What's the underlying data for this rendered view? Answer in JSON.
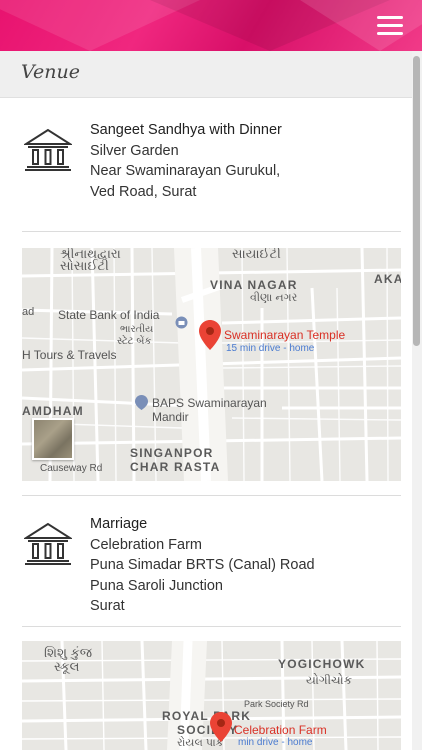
{
  "header": {
    "menu_icon": "hamburger-menu-icon"
  },
  "section": {
    "title": "Venue"
  },
  "venues": [
    {
      "icon": "temple-building-icon",
      "lines": [
        "Sangeet Sandhya with Dinner",
        "Silver Garden",
        "Near Swaminarayan Gurukul,",
        "Ved Road, Surat"
      ],
      "map": {
        "place_name": "Swaminarayan Temple",
        "drive_info": "15 min drive - home",
        "labels": {
          "vina_nagar": "VINA NAGAR",
          "vina_nagar_guj": "વીણા નગર",
          "society_guj_1": "શ્રીનાથદ્વારા",
          "society_guj_2": "સોસાઈટી",
          "society_guj_3": "સાયાઈટી",
          "aka": "AKA",
          "sbi": "State Bank of India",
          "sbi_guj_1": "ભારતીય",
          "sbi_guj_2": "સ્ટેટ બેંક",
          "tours": "H Tours & Travels",
          "amdham": "AMDHAM",
          "baps": "BAPS Swaminarayan",
          "mandir": "Mandir",
          "singanpor": "SINGANPOR",
          "char_rasta": "CHAR RASTA",
          "causeway": "Causeway Rd",
          "ad": "ad"
        }
      }
    },
    {
      "icon": "temple-building-icon",
      "lines": [
        "Marriage",
        "Celebration Farm",
        "Puna Simadar BRTS (Canal) Road",
        "Puna Saroli Junction",
        "Surat"
      ],
      "map": {
        "place_name": "Celebration Farm",
        "drive_info": "min drive - home",
        "labels": {
          "shishu_1": "શિશુ કુંજ",
          "shishu_2": "સ્કૂલ",
          "yogichowk": "YOGICHOWK",
          "yogichowk_guj": "યોગીચોક",
          "royal_park": "ROYAL PARK",
          "society": "SOCIETY",
          "royal_guj": "રોયલ પાર્ક",
          "park_rd": "Park Society Rd"
        }
      }
    }
  ],
  "colors": {
    "header_pink": "#e8136f",
    "pin_red": "#ea4335",
    "place_red": "#d93025",
    "drive_blue": "#4a7bd0"
  }
}
